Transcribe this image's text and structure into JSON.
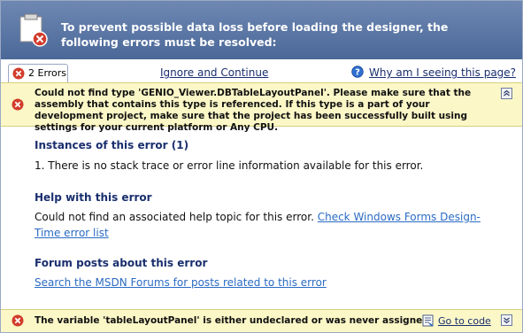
{
  "header": {
    "message": "To prevent possible data loss before loading the designer, the following errors must be resolved:"
  },
  "toolbar": {
    "errors_tab_label": "2 Errors",
    "ignore_link": "Ignore and Continue",
    "why_link": "Why am I seeing this page?"
  },
  "error1": {
    "message": "Could not find type 'GENIO_Viewer.DBTableLayoutPanel'. Please make sure that the assembly that contains this type is referenced. If this type is a part of your development project, make sure that the project has been successfully built using settings for your current platform or Any CPU."
  },
  "details": {
    "instances_title": "Instances of this error (1)",
    "instance_item": "1.   There is no stack trace or error line information available for this error.",
    "help_title": "Help with this error",
    "help_text_line1": "Could not find an associated help topic for this error.",
    "help_link_part1": "Check Windows Forms Design-",
    "help_link_part2": "Time error list",
    "forum_title": "Forum posts about this error",
    "forum_link": "Search the MSDN Forums for posts related to this error"
  },
  "error2": {
    "message": "The variable 'tableLayoutPanel' is either undeclared or was never assigned.",
    "goto_link": "Go to code"
  },
  "colors": {
    "header_bg": "#4a6898",
    "banner_bg": "#fbf7c7",
    "title_text": "#1a2f6e",
    "link": "#2a6bc4",
    "error_red": "#d23b2b"
  }
}
